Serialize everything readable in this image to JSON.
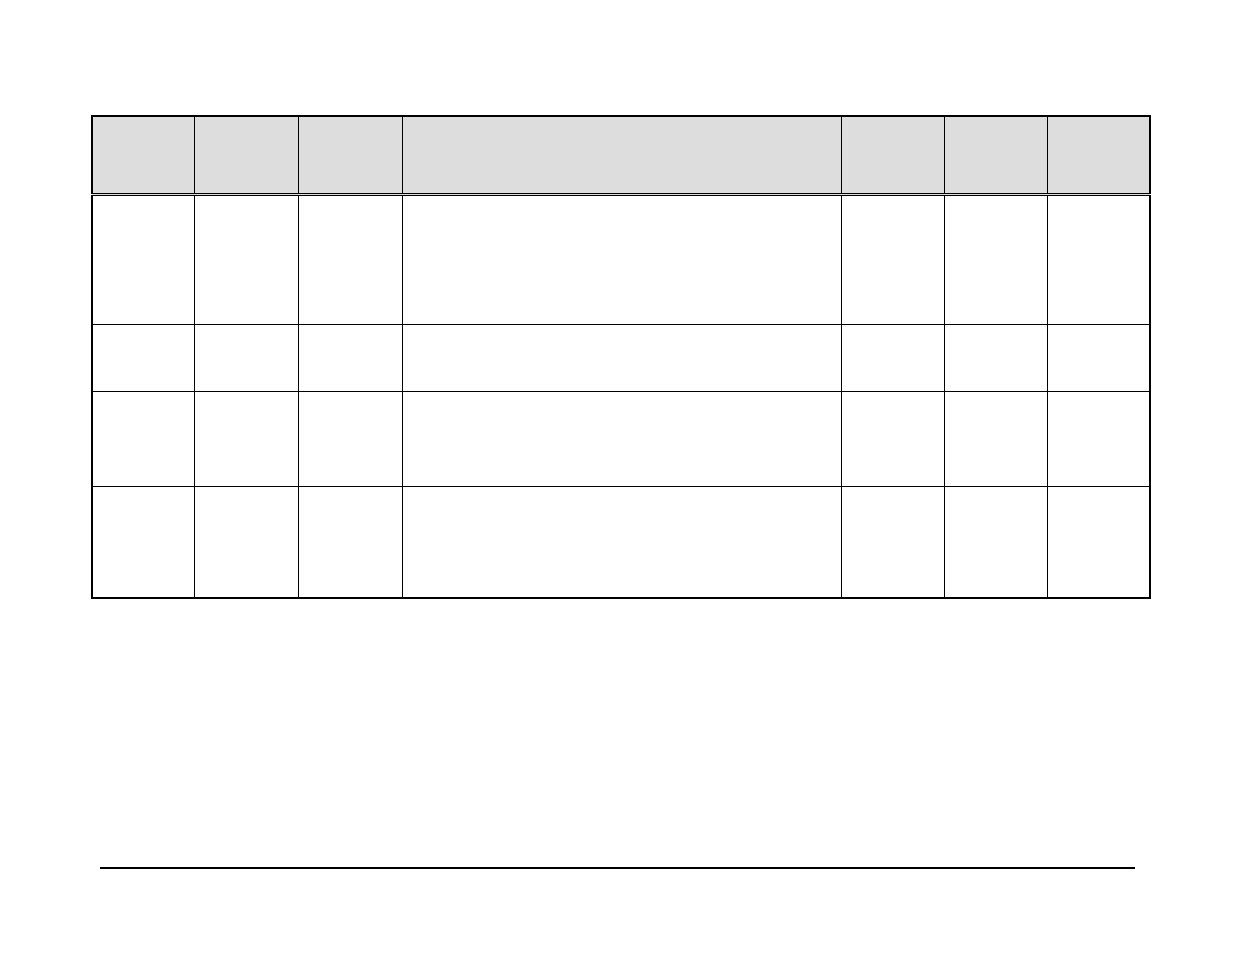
{
  "table": {
    "headers": [
      "",
      "",
      "",
      "",
      "",
      "",
      ""
    ],
    "rows": [
      [
        "",
        "",
        "",
        "",
        "",
        "",
        ""
      ],
      [
        "",
        "",
        "",
        "",
        "",
        "",
        ""
      ],
      [
        "",
        "",
        "",
        "",
        "",
        "",
        ""
      ],
      [
        "",
        "",
        "",
        "",
        "",
        "",
        ""
      ]
    ]
  }
}
